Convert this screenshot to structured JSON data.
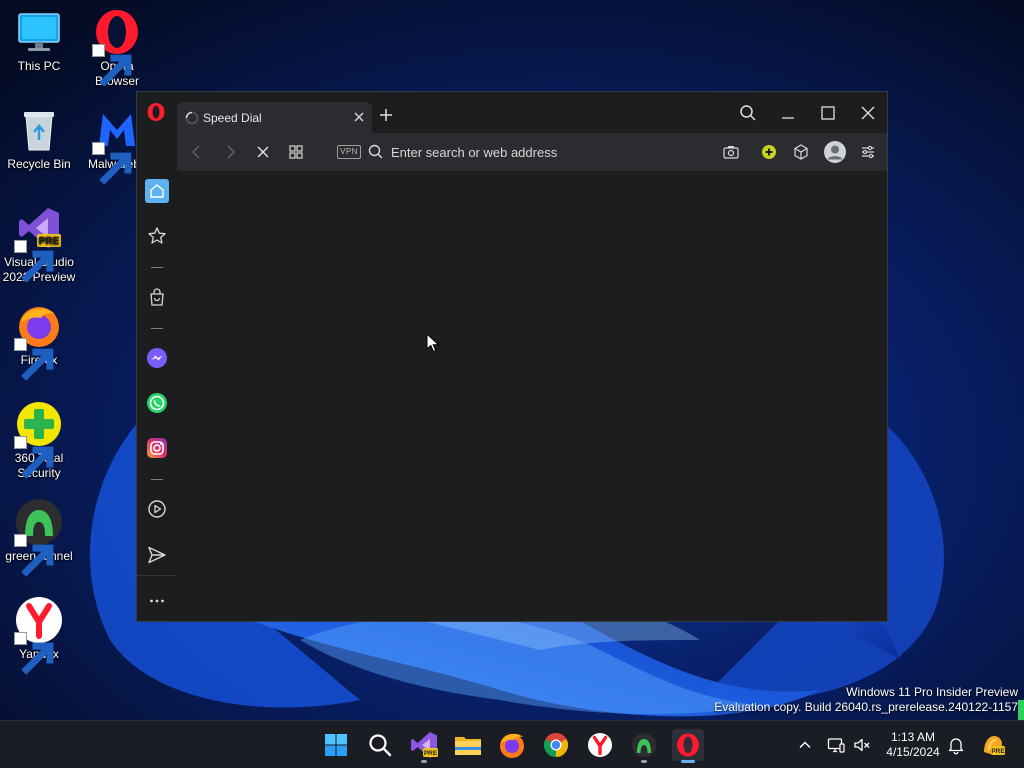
{
  "desktop": {
    "icons": [
      {
        "label": "This PC",
        "icon": "monitor-icon"
      },
      {
        "label": "Opera\nBrowser",
        "icon": "opera-icon"
      },
      {
        "label": "Recycle Bin",
        "icon": "recycle-bin-icon"
      },
      {
        "label": "Malwareby",
        "icon": "malwarebytes-icon"
      },
      {
        "label": "Visual Studio\n2022 Preview",
        "icon": "visual-studio-icon",
        "badge": "PRE"
      },
      {
        "label": "Firefox",
        "icon": "firefox-icon"
      },
      {
        "label": "360 Total\nSecurity",
        "icon": "360-security-icon"
      },
      {
        "label": "green-tunnel",
        "icon": "green-tunnel-icon"
      },
      {
        "label": "Yandex",
        "icon": "yandex-icon"
      }
    ]
  },
  "browser": {
    "app": "Opera",
    "tab": {
      "title": "Speed Dial",
      "loading": true
    },
    "vpn_label": "VPN",
    "address_placeholder": "Enter search or web address",
    "address_value": "",
    "toolbar_icons": [
      "back-icon",
      "forward-icon",
      "stop-icon",
      "tabs-overview-icon",
      "vpn-badge",
      "search-icon",
      "camera-icon",
      "crypto-wallet-icon",
      "cube-icon",
      "profile-icon",
      "easy-setup-icon"
    ],
    "sidebar_icons": [
      "home-icon",
      "bookmarks-icon",
      "shopping-icon",
      "messenger-icon",
      "whatsapp-icon",
      "instagram-icon",
      "player-icon",
      "send-icon",
      "more-icon"
    ],
    "window_controls": [
      "search-tabs-icon",
      "minimize-icon",
      "maximize-icon",
      "close-icon"
    ]
  },
  "watermark": {
    "line1": "Windows 11 Pro Insider Preview",
    "line2": "Evaluation copy. Build 26040.rs_prerelease.240122-1157"
  },
  "taskbar": {
    "apps": [
      "start-icon",
      "search-icon",
      "visual-studio-icon",
      "file-explorer-icon",
      "firefox-icon",
      "chrome-icon",
      "yandex-icon",
      "green-tunnel-icon",
      "opera-icon"
    ],
    "active_app": "opera-icon",
    "pre_badge": "PRE",
    "clock": {
      "time": "1:13 AM",
      "date": "4/15/2024"
    }
  },
  "colors": {
    "accent": "#5fb2f2",
    "opera_red": "#ff1b2d",
    "browser_bg": "#1c1d1f",
    "toolbar_bg": "#2b2c30",
    "taskbar_bg": "#1b1d24"
  }
}
